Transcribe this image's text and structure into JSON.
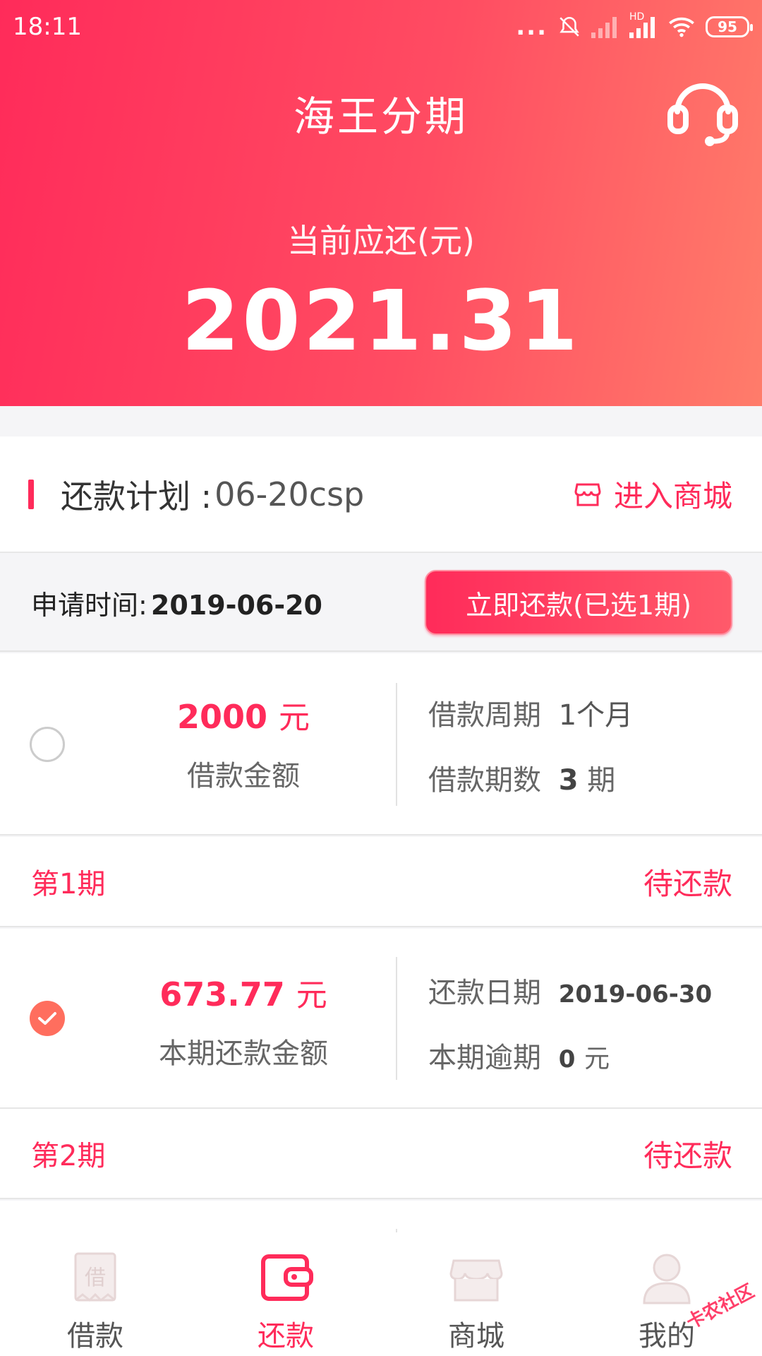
{
  "status_bar": {
    "time": "18:11",
    "dots": "...",
    "battery": "95",
    "hd": "HD"
  },
  "header": {
    "title": "海王分期",
    "due_label": "当前应还(元)",
    "due_amount": "2021.31"
  },
  "plan": {
    "title_prefix": "还款计划 :",
    "code": "06-20csp",
    "mall_link": "进入商城"
  },
  "apply": {
    "label": "申请时间:",
    "date": "2019-06-20",
    "repay_button": "立即还款(已选1期)"
  },
  "loan_card": {
    "amount": "2000",
    "unit": "元",
    "amount_label": "借款金额",
    "cycle_label": "借款周期",
    "cycle_value": "1个月",
    "count_label": "借款期数",
    "count_value": "3",
    "count_unit": "期"
  },
  "periods": [
    {
      "name": "第1期",
      "status": "待还款",
      "amount": "673.77",
      "unit": "元",
      "amount_label": "本期还款金额",
      "date_label": "还款日期",
      "date_value": "2019-06-30",
      "overdue_label": "本期逾期",
      "overdue_value": "0",
      "overdue_unit": "元",
      "checked": true
    },
    {
      "name": "第2期",
      "status": "待还款"
    }
  ],
  "tabbar": {
    "items": [
      {
        "label": "借款",
        "icon": "borrow-icon",
        "icon_glyph": "借",
        "active": false
      },
      {
        "label": "还款",
        "icon": "wallet-icon",
        "active": true
      },
      {
        "label": "商城",
        "icon": "store-icon",
        "active": false
      },
      {
        "label": "我的",
        "icon": "user-icon",
        "active": false
      }
    ]
  },
  "watermark": "卡农社区",
  "colors": {
    "accent": "#ff2b5a",
    "header_gradient_start": "#ff2b5a",
    "header_gradient_end": "#ff7c6a",
    "checked": "#ff6e5e"
  }
}
